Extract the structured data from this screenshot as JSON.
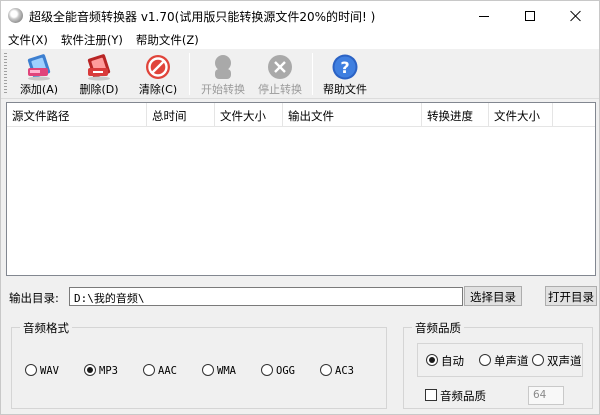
{
  "window": {
    "title": "超级全能音频转换器 v1.70(试用版只能转换源文件20%的时间! )"
  },
  "menu": [
    {
      "label": "文件(X)"
    },
    {
      "label": "软件注册(Y)"
    },
    {
      "label": "帮助文件(Z)"
    }
  ],
  "toolbar": {
    "add": {
      "label": "添加(A)",
      "icon": "add-file-icon",
      "enabled": true
    },
    "delete": {
      "label": "删除(D)",
      "icon": "delete-file-icon",
      "enabled": true
    },
    "clear": {
      "label": "清除(C)",
      "icon": "clear-forbidden-icon",
      "enabled": true
    },
    "start": {
      "label": "开始转换",
      "icon": "person-icon",
      "enabled": false
    },
    "stop": {
      "label": "停止转换",
      "icon": "stop-x-icon",
      "enabled": false
    },
    "help": {
      "label": "帮助文件",
      "icon": "help-question-icon",
      "enabled": true
    }
  },
  "list": {
    "columns": [
      "源文件路径",
      "总时间",
      "文件大小",
      "输出文件",
      "转换进度",
      "文件大小"
    ],
    "rows": []
  },
  "output": {
    "label": "输出目录:",
    "path": "D:\\我的音频\\",
    "choose_button": "选择目录",
    "open_button": "打开目录"
  },
  "format": {
    "legend": "音频格式",
    "options": [
      "WAV",
      "MP3",
      "AAC",
      "WMA",
      "OGG",
      "AC3"
    ],
    "selected": "MP3"
  },
  "quality": {
    "legend": "音频品质",
    "channel_options": [
      "自动",
      "单声道",
      "双声道"
    ],
    "selected": "自动",
    "checkbox_label": "音频品质",
    "checkbox_checked": false,
    "value": "64"
  },
  "colors": {
    "title_bar": "#ffffff",
    "window_bg": "#f0f0f0",
    "help_icon": "#2b62c4",
    "delete_icon": "#d93a3a",
    "clear_icon": "#e0443a",
    "disabled_icon": "#a9a9a9"
  }
}
